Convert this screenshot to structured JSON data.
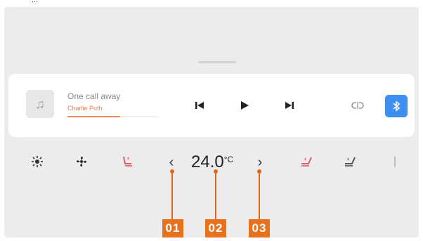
{
  "top_caption": "...",
  "media": {
    "song_title": "One call away",
    "artist": "Charlie Puth",
    "progress": 0.58
  },
  "climate": {
    "temperature": "24.0",
    "unit": "°C",
    "decrease": "‹",
    "increase": "›"
  },
  "callouts": [
    "01",
    "02",
    "03"
  ],
  "colors": {
    "accent_orange": "#e8711d",
    "media_blue": "#3c8ef1",
    "seat_heat": "#e05a6a"
  }
}
